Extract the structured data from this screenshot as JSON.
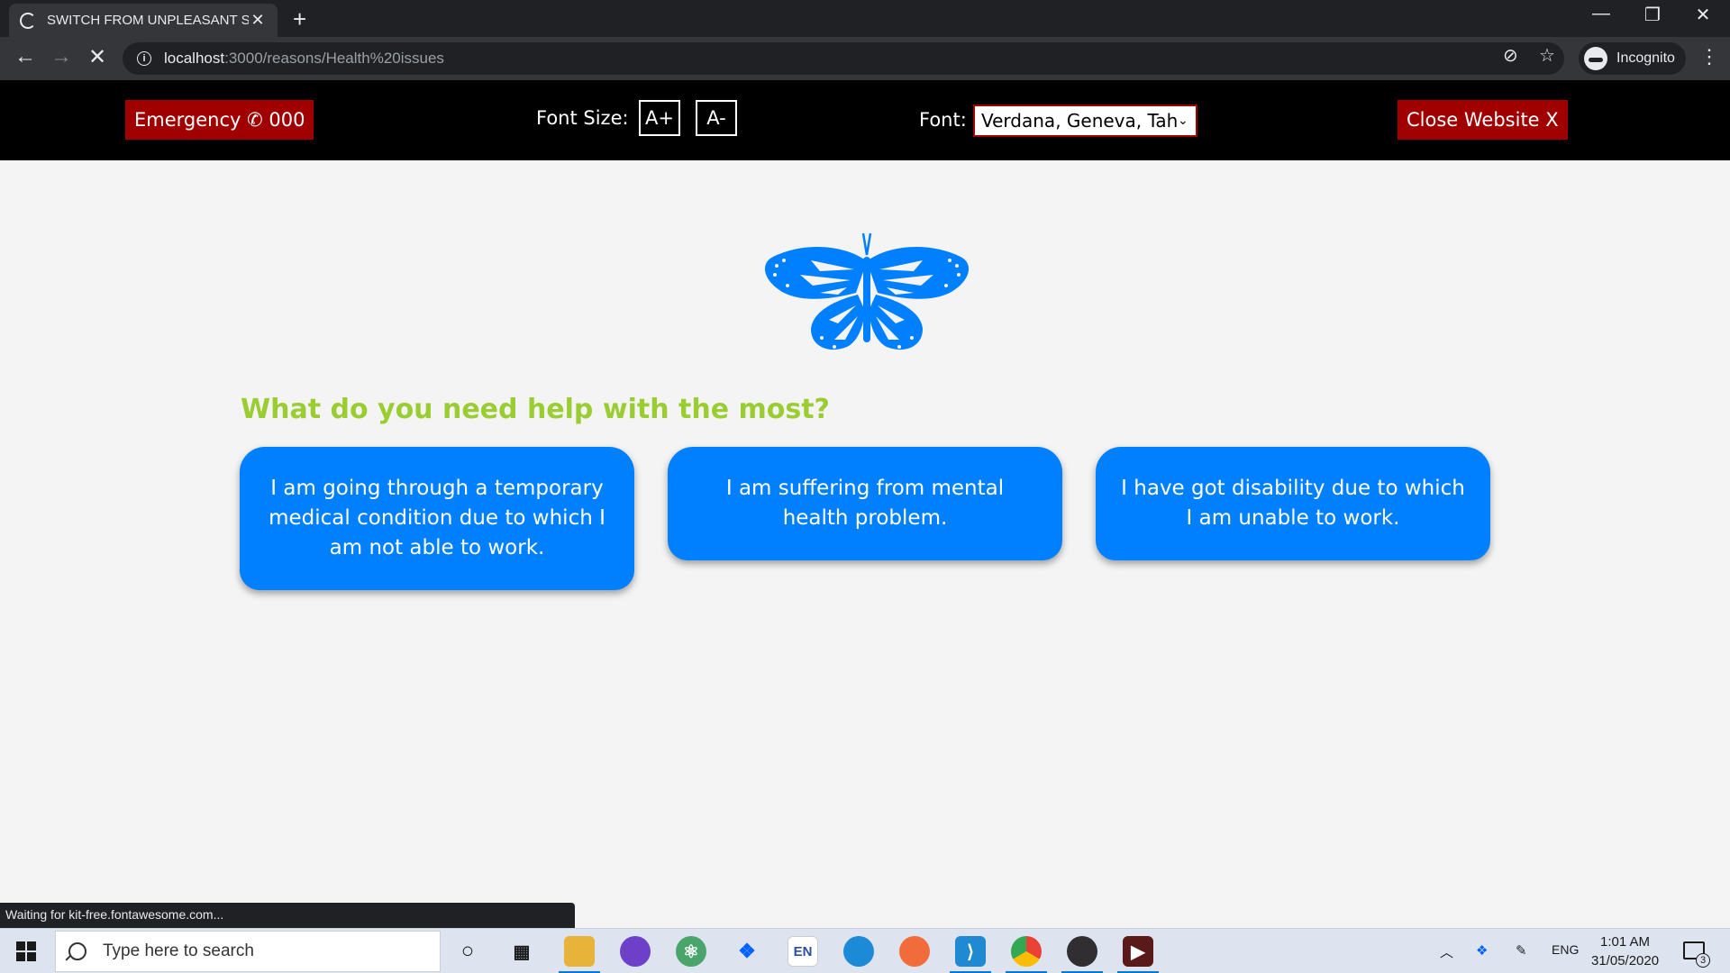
{
  "browser": {
    "tab_title": "SWITCH FROM UNPLEASANT SC",
    "url_host": "localhost",
    "url_path": ":3000/reasons/Health%20issues",
    "profile_label": "Incognito",
    "status_text": "Waiting for kit-free.fontawesome.com...",
    "new_tab_glyph": "+",
    "close_glyph": "✕",
    "back_glyph": "←",
    "forward_glyph": "→",
    "stop_glyph": "✕"
  },
  "site_header": {
    "emergency_label": "Emergency ✆ 000",
    "font_size_label": "Font Size:",
    "increase_label": "A+",
    "decrease_label": "A-",
    "font_label": "Font:",
    "font_value": "Verdana, Geneva, Tahoma, sans-serif",
    "close_label": "Close Website X",
    "accent_color": "#a10000"
  },
  "main": {
    "question": "What do you need help with the most?",
    "question_color": "#9acd32",
    "card_color": "#0080ff",
    "options": [
      {
        "label": "I am going through a temporary medical condition due to which I am not able to work."
      },
      {
        "label": "I am suffering from mental health problem."
      },
      {
        "label": "I have got disability due to which I am unable to work."
      }
    ]
  },
  "taskbar": {
    "search_placeholder": "Type here to search",
    "language": "ENG",
    "time": "1:01 AM",
    "date": "31/05/2020",
    "notification_count": "3",
    "apps": [
      "cortana-icon",
      "task-view-icon",
      "file-explorer-icon",
      "github-desktop-icon",
      "atom-icon",
      "dropbox-icon",
      "en-input-icon",
      "edge-icon",
      "postman-icon",
      "vscode-icon",
      "chrome-icon",
      "obs-icon",
      "media-player-icon"
    ]
  }
}
